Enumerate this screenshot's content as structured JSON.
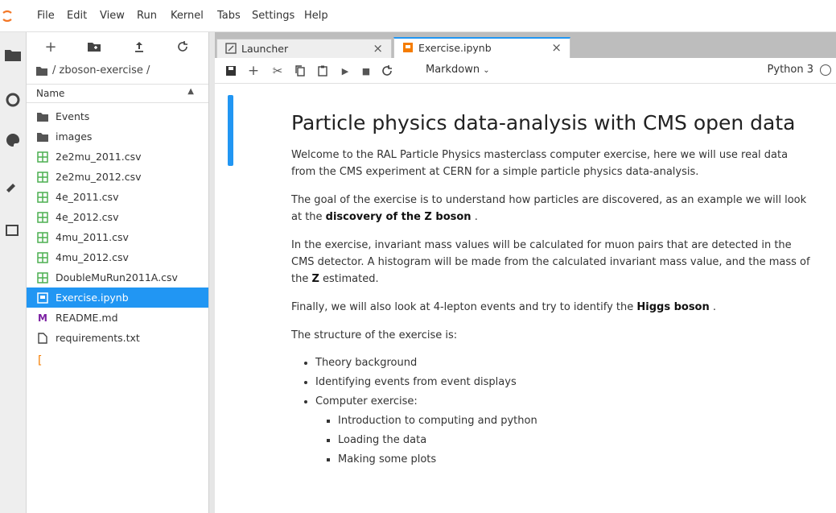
{
  "menu": [
    "File",
    "Edit",
    "View",
    "Run",
    "Kernel",
    "Tabs",
    "Settings",
    "Help"
  ],
  "filebrowser": {
    "breadcrumb": "/ zboson-exercise /",
    "header": "Name",
    "items": [
      {
        "name": "Events",
        "type": "folder"
      },
      {
        "name": "images",
        "type": "folder"
      },
      {
        "name": "2e2mu_2011.csv",
        "type": "csv"
      },
      {
        "name": "2e2mu_2012.csv",
        "type": "csv"
      },
      {
        "name": "4e_2011.csv",
        "type": "csv"
      },
      {
        "name": "4e_2012.csv",
        "type": "csv"
      },
      {
        "name": "4mu_2011.csv",
        "type": "csv"
      },
      {
        "name": "4mu_2012.csv",
        "type": "csv"
      },
      {
        "name": "DoubleMuRun2011A.csv",
        "type": "csv"
      },
      {
        "name": "Exercise.ipynb",
        "type": "notebook",
        "selected": true
      },
      {
        "name": "README.md",
        "type": "markdown"
      },
      {
        "name": "requirements.txt",
        "type": "text"
      }
    ]
  },
  "tabs": [
    {
      "label": "Launcher",
      "active": false
    },
    {
      "label": "Exercise.ipynb",
      "active": true
    }
  ],
  "toolbar": {
    "cell_type": "Markdown",
    "kernel": "Python 3"
  },
  "notebook": {
    "title": "Particle physics data-analysis with CMS open data",
    "p1": "Welcome to the RAL Particle Physics masterclass computer exercise, here we will use real data from the CMS experiment at CERN for a simple particle physics data-analysis.",
    "p2_pre": "The goal of the exercise is to understand how particles are discovered, as an example we will look at the ",
    "p2_bold": "discovery of the Z boson",
    "p2_post": " .",
    "p3_pre": "In the exercise, invariant mass values will be calculated for muon pairs that are detected in the CMS detector. A histogram will be made from the calculated invariant mass value, and the mass of the ",
    "p3_bold": "Z",
    "p3_post": " estimated.",
    "p4_pre": "Finally, we will also look at 4-lepton events and try to identify the ",
    "p4_bold": "Higgs boson",
    "p4_post": " .",
    "p5": "The structure of the exercise is:",
    "list": [
      "Theory background",
      "Identifying events from event displays",
      "Computer exercise:"
    ],
    "sublist": [
      "Introduction to computing and python",
      "Loading the data",
      "Making some plots"
    ]
  },
  "colors": {
    "accent": "#2196f3",
    "csv_icon": "#4caf50",
    "notebook_icon": "#f57c00",
    "markdown_icon": "#7b1fa2"
  }
}
